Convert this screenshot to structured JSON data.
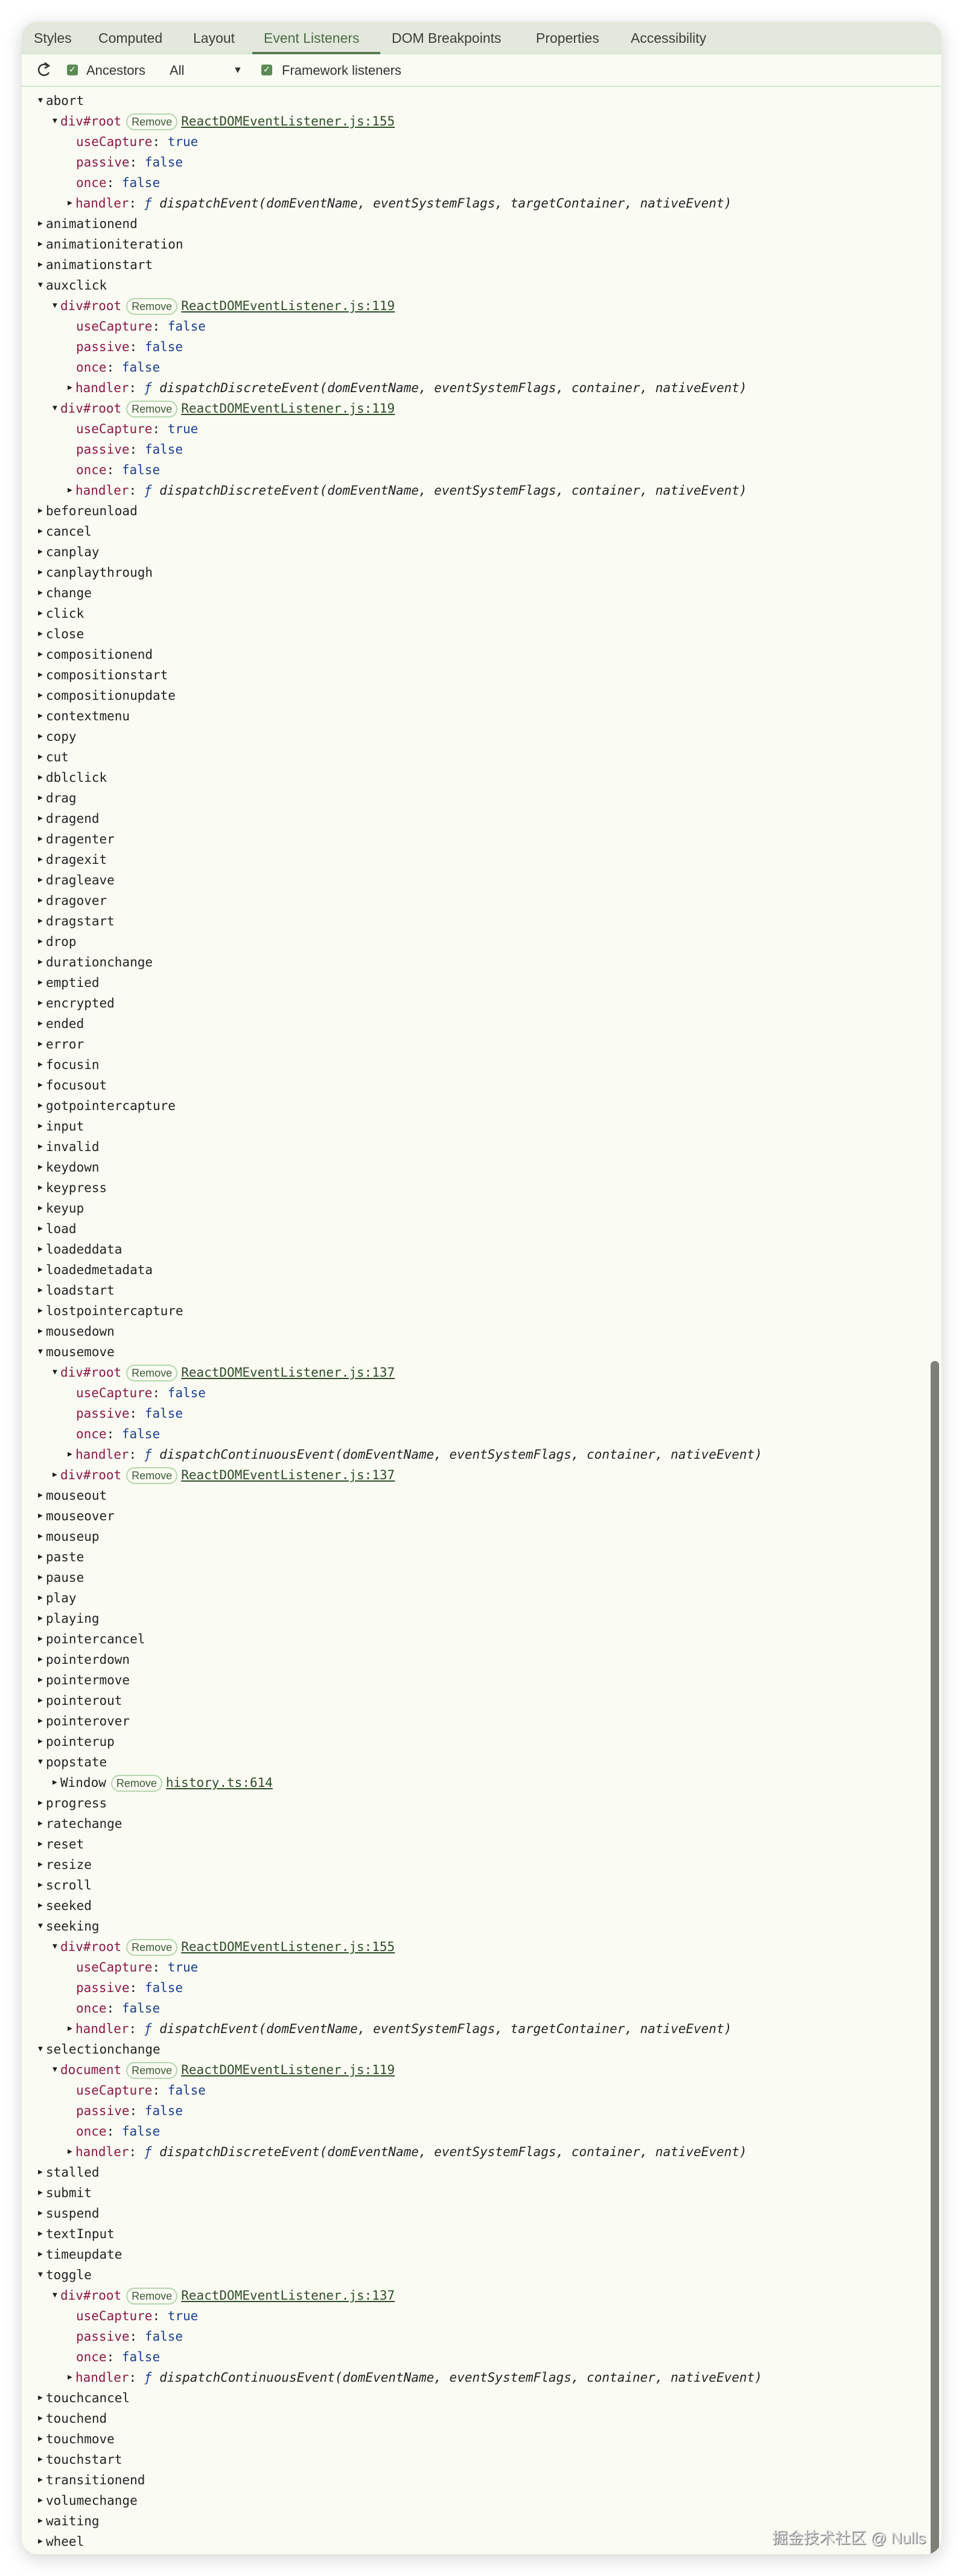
{
  "tabs": [
    {
      "label": "Styles",
      "active": false
    },
    {
      "label": "Computed",
      "active": false
    },
    {
      "label": "Layout",
      "active": false
    },
    {
      "label": "Event Listeners",
      "active": true
    },
    {
      "label": "DOM Breakpoints",
      "active": false
    },
    {
      "label": "Properties",
      "active": false
    },
    {
      "label": "Accessibility",
      "active": false
    }
  ],
  "toolbar": {
    "refresh_icon": "refresh-icon",
    "ancestors_label": "Ancestors",
    "ancestors_checked": true,
    "filter_value": "All",
    "dropdown_icon": "▼",
    "framework_label": "Framework listeners",
    "framework_checked": true
  },
  "handler_label": "handler",
  "function_symbol": "ƒ",
  "remove_label": "Remove",
  "watermark": "掘金技术社区 @ Nulls",
  "events": [
    {
      "name": "abort",
      "expanded": true,
      "listeners": [
        {
          "target": "div#root",
          "expanded": true,
          "link": "ReactDOMEventListener.js:155",
          "useCapture": "true",
          "passive": "false",
          "once": "false",
          "handler": "dispatchEvent(domEventName, eventSystemFlags, targetContainer, nativeEvent)"
        }
      ]
    },
    {
      "name": "animationend"
    },
    {
      "name": "animationiteration"
    },
    {
      "name": "animationstart"
    },
    {
      "name": "auxclick",
      "expanded": true,
      "listeners": [
        {
          "target": "div#root",
          "expanded": true,
          "link": "ReactDOMEventListener.js:119",
          "useCapture": "false",
          "passive": "false",
          "once": "false",
          "handler": "dispatchDiscreteEvent(domEventName, eventSystemFlags, container, nativeEvent)"
        },
        {
          "target": "div#root",
          "expanded": true,
          "link": "ReactDOMEventListener.js:119",
          "useCapture": "true",
          "passive": "false",
          "once": "false",
          "handler": "dispatchDiscreteEvent(domEventName, eventSystemFlags, container, nativeEvent)"
        }
      ]
    },
    {
      "name": "beforeunload"
    },
    {
      "name": "cancel"
    },
    {
      "name": "canplay"
    },
    {
      "name": "canplaythrough"
    },
    {
      "name": "change"
    },
    {
      "name": "click"
    },
    {
      "name": "close"
    },
    {
      "name": "compositionend"
    },
    {
      "name": "compositionstart"
    },
    {
      "name": "compositionupdate"
    },
    {
      "name": "contextmenu"
    },
    {
      "name": "copy"
    },
    {
      "name": "cut"
    },
    {
      "name": "dblclick"
    },
    {
      "name": "drag"
    },
    {
      "name": "dragend"
    },
    {
      "name": "dragenter"
    },
    {
      "name": "dragexit"
    },
    {
      "name": "dragleave"
    },
    {
      "name": "dragover"
    },
    {
      "name": "dragstart"
    },
    {
      "name": "drop"
    },
    {
      "name": "durationchange"
    },
    {
      "name": "emptied"
    },
    {
      "name": "encrypted"
    },
    {
      "name": "ended"
    },
    {
      "name": "error"
    },
    {
      "name": "focusin"
    },
    {
      "name": "focusout"
    },
    {
      "name": "gotpointercapture"
    },
    {
      "name": "input"
    },
    {
      "name": "invalid"
    },
    {
      "name": "keydown"
    },
    {
      "name": "keypress"
    },
    {
      "name": "keyup"
    },
    {
      "name": "load"
    },
    {
      "name": "loadeddata"
    },
    {
      "name": "loadedmetadata"
    },
    {
      "name": "loadstart"
    },
    {
      "name": "lostpointercapture"
    },
    {
      "name": "mousedown"
    },
    {
      "name": "mousemove",
      "expanded": true,
      "listeners": [
        {
          "target": "div#root",
          "expanded": true,
          "link": "ReactDOMEventListener.js:137",
          "useCapture": "false",
          "passive": "false",
          "once": "false",
          "handler": "dispatchContinuousEvent(domEventName, eventSystemFlags, container, nativeEvent)"
        },
        {
          "target": "div#root",
          "expanded": false,
          "link": "ReactDOMEventListener.js:137"
        }
      ]
    },
    {
      "name": "mouseout"
    },
    {
      "name": "mouseover"
    },
    {
      "name": "mouseup"
    },
    {
      "name": "paste"
    },
    {
      "name": "pause"
    },
    {
      "name": "play"
    },
    {
      "name": "playing"
    },
    {
      "name": "pointercancel"
    },
    {
      "name": "pointerdown"
    },
    {
      "name": "pointermove"
    },
    {
      "name": "pointerout"
    },
    {
      "name": "pointerover"
    },
    {
      "name": "pointerup"
    },
    {
      "name": "popstate",
      "expanded": true,
      "listeners": [
        {
          "target": "Window",
          "expanded": false,
          "link": "history.ts:614"
        }
      ]
    },
    {
      "name": "progress"
    },
    {
      "name": "ratechange"
    },
    {
      "name": "reset"
    },
    {
      "name": "resize"
    },
    {
      "name": "scroll"
    },
    {
      "name": "seeked"
    },
    {
      "name": "seeking",
      "expanded": true,
      "listeners": [
        {
          "target": "div#root",
          "expanded": true,
          "link": "ReactDOMEventListener.js:155",
          "useCapture": "true",
          "passive": "false",
          "once": "false",
          "handler": "dispatchEvent(domEventName, eventSystemFlags, targetContainer, nativeEvent)"
        }
      ]
    },
    {
      "name": "selectionchange",
      "expanded": true,
      "listeners": [
        {
          "target": "document",
          "expanded": true,
          "link": "ReactDOMEventListener.js:119",
          "useCapture": "false",
          "passive": "false",
          "once": "false",
          "handler": "dispatchDiscreteEvent(domEventName, eventSystemFlags, container, nativeEvent)"
        }
      ]
    },
    {
      "name": "stalled"
    },
    {
      "name": "submit"
    },
    {
      "name": "suspend"
    },
    {
      "name": "textInput"
    },
    {
      "name": "timeupdate"
    },
    {
      "name": "toggle",
      "expanded": true,
      "listeners": [
        {
          "target": "div#root",
          "expanded": true,
          "link": "ReactDOMEventListener.js:137",
          "useCapture": "true",
          "passive": "false",
          "once": "false",
          "handler": "dispatchContinuousEvent(domEventName, eventSystemFlags, container, nativeEvent)"
        }
      ]
    },
    {
      "name": "touchcancel"
    },
    {
      "name": "touchend"
    },
    {
      "name": "touchmove"
    },
    {
      "name": "touchstart"
    },
    {
      "name": "transitionend"
    },
    {
      "name": "volumechange"
    },
    {
      "name": "waiting"
    },
    {
      "name": "wheel"
    }
  ]
}
